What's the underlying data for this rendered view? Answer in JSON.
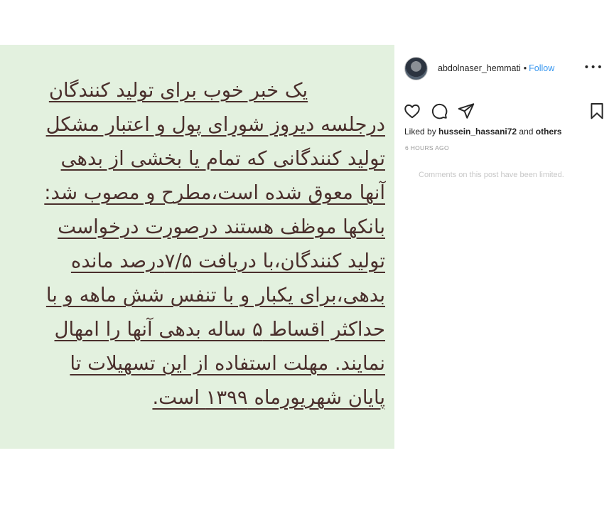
{
  "post": {
    "lines": [
      "یک خبر خوب برای تولید کنندگان",
      "درجلسه دیروز شورای پول و اعتبار مشکل",
      "تولید کنندگانی که تمام یا بخشی از بدهی",
      "آنها معوق شده است،مطرح و مصوب شد:",
      "بانکها موظف هستند درصورت درخواست",
      "تولید کنندگان،با دریافت ۷/۵درصد مانده",
      "بدهی،برای یکبار و با تنفس شش ماهه و با",
      "حداکثر اقساط ۵ ساله بدهی آنها را امهال",
      "نمایند. مهلت استفاده از این تسهیلات تا",
      "پایان شهریورماه ۱۳۹۹ است."
    ]
  },
  "header": {
    "username": "abdolnaser_hemmati",
    "separator": "•",
    "follow_label": "Follow",
    "more_label": "•••"
  },
  "icons": {
    "like": "heart-icon",
    "comment": "comment-icon",
    "share": "share-icon",
    "save": "bookmark-icon"
  },
  "likes": {
    "prefix": "Liked by ",
    "user": "hussein_hassani72",
    "middle": " and ",
    "others": "others"
  },
  "timestamp": "6 HOURS AGO",
  "comments_notice": "Comments on this post have been limited.",
  "colors": {
    "post_background": "#e3f1df",
    "post_text": "#4a2f2c",
    "follow": "#3897f0",
    "muted": "#999999"
  }
}
